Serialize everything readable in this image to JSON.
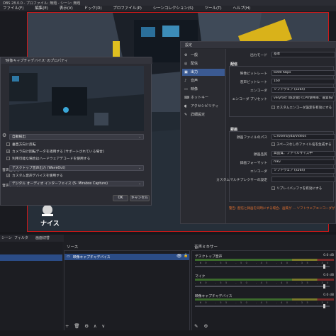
{
  "window": {
    "title": "OBS 28.0.0 - プロファイル: 無題 - シーン: 無題"
  },
  "menubar": [
    "ファイル(F)",
    "編集(E)",
    "表示(V)",
    "ドック(D)",
    "プロファイル(P)",
    "シーンコレクション(S)",
    "ツール(T)",
    "ヘルプ(H)"
  ],
  "preview": {
    "overlay_text": "ナイス"
  },
  "capture_dialog": {
    "title": "'映像キャプチャデバイス' のプロパティ",
    "select_resolution": "自動検出",
    "checkboxes": [
      {
        "label": "垂直方向に反転",
        "checked": false
      },
      {
        "label": "カメラ向け回転データを適用する (サポートされている場合)",
        "checked": true
      },
      {
        "label": "利用可能な場合はハードウェアデコードを使用する",
        "checked": false
      }
    ],
    "audio_output_label": "音声出力モード",
    "audio_output_value": "デスクトップ音声出力 (WaveOut)",
    "custom_audio_checkbox": {
      "label": "カスタム音声デバイスを使用する",
      "checked": true
    },
    "audio_device_label": "音声デバイス",
    "audio_device_value": "デジタル オーディオ インターフェイス (5- Mirabox Capture)",
    "ok_button": "OK",
    "cancel_button": "キャンセル"
  },
  "settings": {
    "title": "設定",
    "nav": [
      {
        "label": "一般",
        "icon": "gear-icon",
        "selected": false
      },
      {
        "label": "配信",
        "icon": "broadcast-icon",
        "selected": false
      },
      {
        "label": "出力",
        "icon": "output-icon",
        "selected": true
      },
      {
        "label": "音声",
        "icon": "speaker-icon",
        "selected": false
      },
      {
        "label": "映像",
        "icon": "monitor-icon",
        "selected": false
      },
      {
        "label": "ホットキー",
        "icon": "keyboard-icon",
        "selected": false
      },
      {
        "label": "アクセシビリティ",
        "icon": "accessibility-icon",
        "selected": false
      },
      {
        "label": "詳細設定",
        "icon": "wrench-icon",
        "selected": false
      }
    ],
    "output_mode_label": "出力モード",
    "output_mode_value": "基本",
    "streaming_section": "配信",
    "streaming": [
      {
        "key": "映像ビットレート",
        "value": "6000 Kbps"
      },
      {
        "key": "音声ビットレート",
        "value": "160"
      },
      {
        "key": "エンコーダ",
        "value": "ソフトウェア (x264)"
      },
      {
        "key": "エンコーダ プリセット",
        "value": "veryfast (既定値) (CPU使用率、画質低)"
      }
    ],
    "streaming_checkbox": "カスタムエンコーダ設定を有効にする",
    "recording_section": "録画",
    "recording": [
      {
        "key": "録画ファイルのパス",
        "value": "C:/Users/yda/Videos"
      },
      {
        "key": "録画品質",
        "value": "高品質、ファイルサイズ中"
      },
      {
        "key": "録画フォーマット",
        "value": "mkv"
      },
      {
        "key": "エンコーダ",
        "value": "ソフトウェア (x264)"
      },
      {
        "key": "カスタムマルチプレクサーの設定",
        "value": ""
      }
    ],
    "recording_checkbox_1": "スペースなしのファイル名を生成する",
    "recording_checkbox_2": "リプレイバッファを有効にする",
    "warning": "警告: 配信と録画を同時にする場合、画質が ... ソフトウェアエンコーダが使用されます。"
  },
  "scenes_dock": {
    "tabs": [
      "シーン",
      "フィルタ"
    ],
    "transition_label": "画面切替"
  },
  "sources_dock": {
    "title": "ソース",
    "items": [
      {
        "label": "映像キャプチャデバイス",
        "visible": true,
        "locked": false
      }
    ],
    "toolbar": [
      "+",
      "🗑",
      "⚙",
      "∧",
      "∨"
    ]
  },
  "mixer_dock": {
    "title": "音声ミキサー",
    "tracks": [
      {
        "name": "デスクトップ音声",
        "db": "0.0 dB",
        "level": 0.95
      },
      {
        "name": "マイク",
        "db": "0.0 dB",
        "level": 0.95
      },
      {
        "name": "映像キャプチャデバイス",
        "db": "0.0 dB",
        "level": 0.95
      }
    ],
    "ticks": "-60 -55 -50 -45 -40 -35 -30 -25 -20 -15 -10 -5 0"
  },
  "colors": {
    "accent": "#2b4c86",
    "preview_border": "#d01818",
    "warning": "#e07030"
  }
}
